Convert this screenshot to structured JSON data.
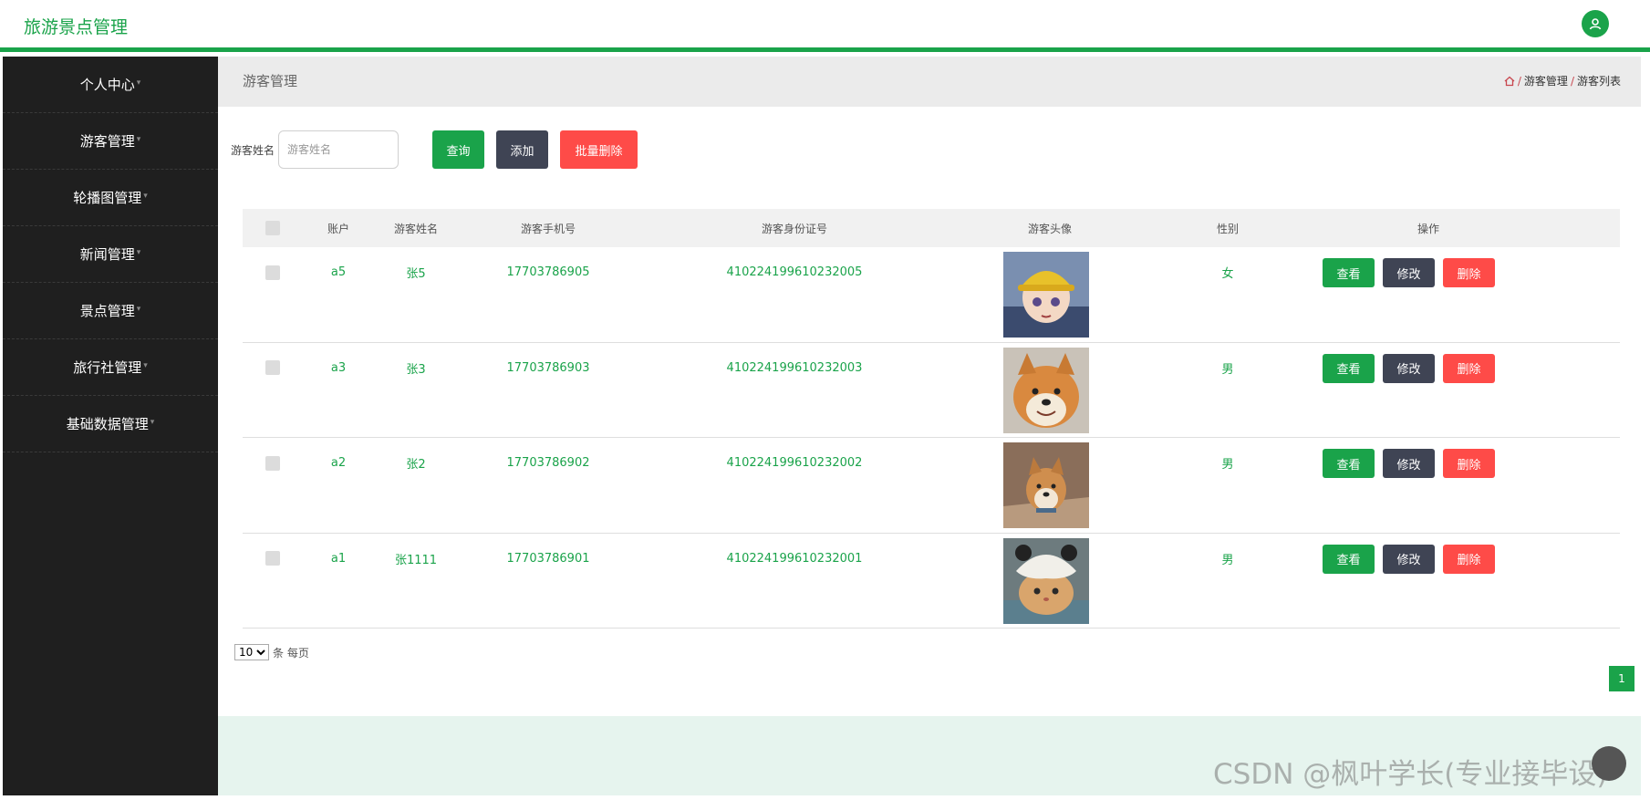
{
  "app": {
    "title": "旅游景点管理"
  },
  "colors": {
    "accent": "#1aa34a",
    "dark": "#3f4454",
    "danger": "#fe4b48",
    "sidebar": "#1f1f1f"
  },
  "header": {
    "user_icon": "user-icon"
  },
  "sidebar": {
    "items": [
      {
        "label": "个人中心"
      },
      {
        "label": "游客管理"
      },
      {
        "label": "轮播图管理"
      },
      {
        "label": "新闻管理"
      },
      {
        "label": "景点管理"
      },
      {
        "label": "旅行社管理"
      },
      {
        "label": "基础数据管理"
      }
    ]
  },
  "pagebar": {
    "title": "游客管理",
    "breadcrumb": {
      "icon": "home-icon",
      "sep": "/",
      "level1": "游客管理",
      "level2": "游客列表"
    }
  },
  "search": {
    "label": "游客姓名",
    "placeholder": "游客姓名",
    "value": ""
  },
  "toolbar": {
    "query_label": "查询",
    "add_label": "添加",
    "batch_delete_label": "批量删除"
  },
  "table": {
    "headers": {
      "account": "账户",
      "name": "游客姓名",
      "phone": "游客手机号",
      "id_card": "游客身份证号",
      "avatar": "游客头像",
      "gender": "性别",
      "ops": "操作"
    },
    "actions": {
      "view": "查看",
      "edit": "修改",
      "delete": "删除"
    },
    "rows": [
      {
        "account": "a5",
        "name": "张5",
        "phone": "17703786905",
        "id_card": "410224199610232005",
        "gender": "女"
      },
      {
        "account": "a3",
        "name": "张3",
        "phone": "17703786903",
        "id_card": "410224199610232003",
        "gender": "男"
      },
      {
        "account": "a2",
        "name": "张2",
        "phone": "17703786902",
        "id_card": "410224199610232002",
        "gender": "男"
      },
      {
        "account": "a1",
        "name": "张1111",
        "phone": "17703786901",
        "id_card": "410224199610232001",
        "gender": "男"
      }
    ]
  },
  "pagination": {
    "page_size": "10",
    "page_size_suffix": "条 每页",
    "current_page": "1"
  },
  "watermark": "CSDN @枫叶学长(专业接毕设)"
}
